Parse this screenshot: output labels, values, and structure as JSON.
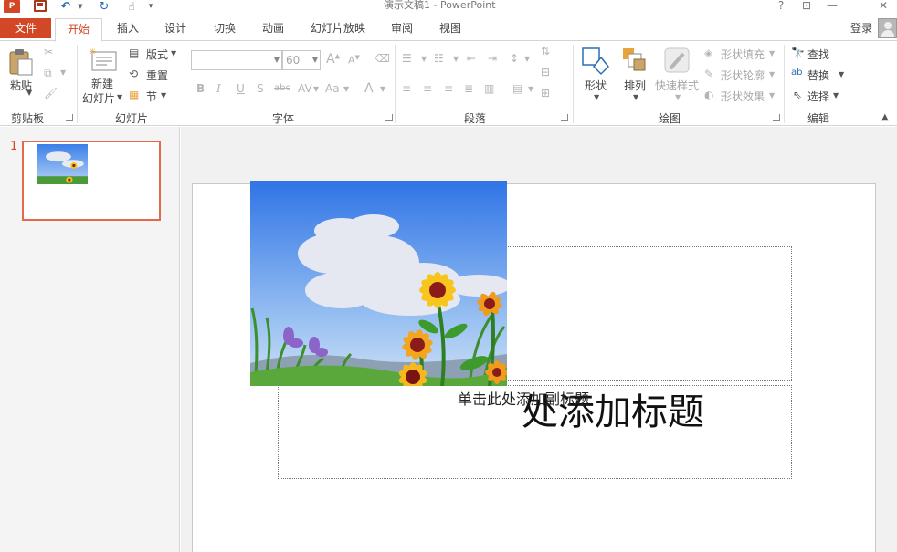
{
  "titlebar": {
    "app_logo": "P",
    "doc_title": "演示文稿1 - PowerPoint",
    "help": "?",
    "ribbon_display": "⊡",
    "minimize": "—",
    "close": "✕"
  },
  "tabs": {
    "file": "文件",
    "home": "开始",
    "insert": "插入",
    "design": "设计",
    "transitions": "切换",
    "animations": "动画",
    "slideshow": "幻灯片放映",
    "review": "审阅",
    "view": "视图",
    "active": "开始"
  },
  "account": {
    "login": "登录"
  },
  "ribbon": {
    "clipboard": {
      "label": "剪贴板",
      "paste": "粘贴"
    },
    "slides": {
      "label": "幻灯片",
      "new_slide_line1": "新建",
      "new_slide_line2": "幻灯片",
      "layout": "版式",
      "reset": "重置",
      "section": "节"
    },
    "font": {
      "label": "字体",
      "font_name": "",
      "font_size": "60",
      "bold": "B",
      "italic": "I",
      "underline": "U",
      "shadow": "S",
      "strike": "abc",
      "spacing": "AV",
      "case": "Aa",
      "color": "A",
      "grow": "A",
      "shrink": "A"
    },
    "paragraph": {
      "label": "段落"
    },
    "drawing": {
      "label": "绘图",
      "shapes": "形状",
      "arrange": "排列",
      "quick_styles": "快速样式",
      "shape_fill": "形状填充",
      "shape_outline": "形状轮廓",
      "shape_effects": "形状效果"
    },
    "editing": {
      "label": "编辑",
      "find": "查找",
      "replace": "替换",
      "select": "选择"
    }
  },
  "thumbnails": [
    {
      "number": "1"
    }
  ],
  "slide": {
    "title_text": "处添加标题",
    "subtitle_text": "单击此处添加副标题"
  },
  "colors": {
    "accent": "#d24726",
    "thumb_border": "#e3694a"
  }
}
